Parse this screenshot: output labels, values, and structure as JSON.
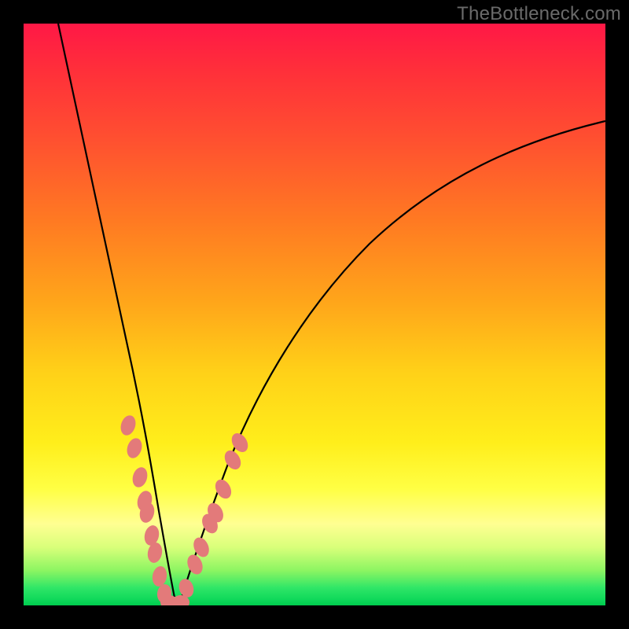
{
  "watermark": "TheBottleneck.com",
  "chart_data": {
    "type": "line",
    "title": "",
    "xlabel": "",
    "ylabel": "",
    "xlim": [
      0,
      100
    ],
    "ylim": [
      0,
      100
    ],
    "background_gradient": {
      "direction": "vertical",
      "stops": [
        {
          "pos": 0,
          "color": "#ff1846",
          "meaning": "high-bottleneck"
        },
        {
          "pos": 50,
          "color": "#ffc018",
          "meaning": "moderate"
        },
        {
          "pos": 85,
          "color": "#ffff55",
          "meaning": "low"
        },
        {
          "pos": 100,
          "color": "#00cc4e",
          "meaning": "balanced"
        }
      ]
    },
    "series": [
      {
        "name": "left-branch",
        "style": "solid-black",
        "x": [
          6,
          8,
          10,
          12,
          14,
          16,
          18,
          20,
          22,
          23.5,
          24,
          25
        ],
        "y": [
          100,
          88,
          76,
          64,
          52,
          41,
          31,
          21,
          13,
          6,
          3,
          0
        ]
      },
      {
        "name": "right-branch",
        "style": "solid-black",
        "x": [
          27,
          28,
          30,
          33,
          37,
          43,
          52,
          62,
          75,
          88,
          100
        ],
        "y": [
          0,
          3,
          8,
          15,
          24,
          36,
          50,
          62,
          72,
          79,
          83
        ]
      }
    ],
    "markers": [
      {
        "name": "left-branch-dots",
        "color": "#e37a7a",
        "shape": "pill",
        "points": [
          {
            "x": 18.0,
            "y": 31
          },
          {
            "x": 19.0,
            "y": 27
          },
          {
            "x": 20.0,
            "y": 22
          },
          {
            "x": 20.8,
            "y": 18
          },
          {
            "x": 21.2,
            "y": 16
          },
          {
            "x": 22.0,
            "y": 12
          },
          {
            "x": 22.6,
            "y": 9
          },
          {
            "x": 23.4,
            "y": 5
          },
          {
            "x": 24.2,
            "y": 2
          },
          {
            "x": 25.0,
            "y": 0.5
          },
          {
            "x": 26.0,
            "y": 0.2
          },
          {
            "x": 27.0,
            "y": 0.5
          }
        ]
      },
      {
        "name": "right-branch-dots",
        "color": "#e37a7a",
        "shape": "pill",
        "points": [
          {
            "x": 28.0,
            "y": 3
          },
          {
            "x": 29.5,
            "y": 7
          },
          {
            "x": 30.5,
            "y": 10
          },
          {
            "x": 32.0,
            "y": 14
          },
          {
            "x": 33.0,
            "y": 16
          },
          {
            "x": 34.3,
            "y": 20
          },
          {
            "x": 36.0,
            "y": 25
          },
          {
            "x": 37.2,
            "y": 28
          }
        ]
      }
    ]
  }
}
